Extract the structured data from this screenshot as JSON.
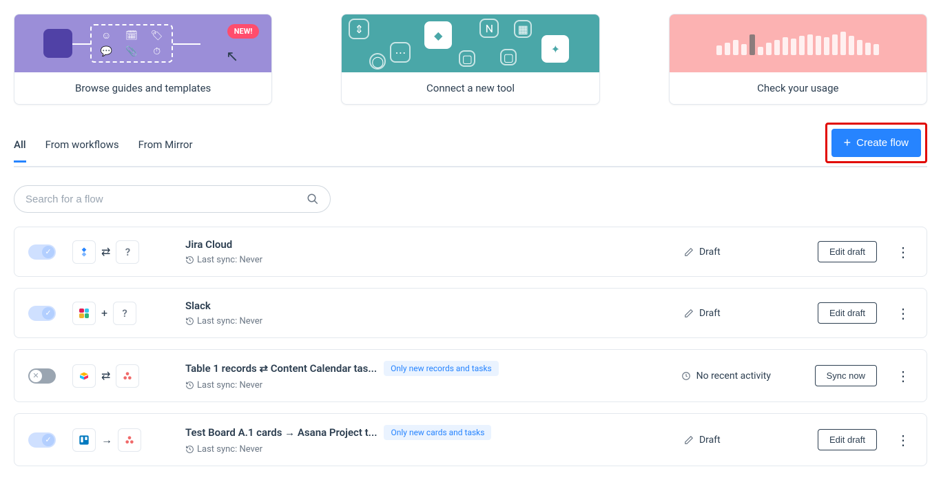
{
  "promo_cards": [
    {
      "label": "Browse guides and templates",
      "new_badge": "NEW!"
    },
    {
      "label": "Connect a new tool"
    },
    {
      "label": "Check your usage"
    }
  ],
  "tabs": {
    "all": "All",
    "from_workflows": "From workflows",
    "from_mirror": "From Mirror"
  },
  "create_button_label": "Create flow",
  "search_placeholder": "Search for a flow",
  "last_sync_prefix": "Last sync:",
  "flows": [
    {
      "title": "Jira Cloud",
      "last_sync": "Never",
      "status_label": "Draft",
      "status_type": "draft",
      "action_label": "Edit draft",
      "toggle_state": "on",
      "mid_arrow": "bidirectional",
      "left_icon": "jira",
      "right_icon": "question",
      "badge": null
    },
    {
      "title": "Slack",
      "last_sync": "Never",
      "status_label": "Draft",
      "status_type": "draft",
      "action_label": "Edit draft",
      "toggle_state": "on",
      "mid_arrow": "plus",
      "left_icon": "slack",
      "right_icon": "question",
      "badge": null
    },
    {
      "title": "Table 1 records ⇄ Content Calendar tas...",
      "last_sync": "Never",
      "status_label": "No recent activity",
      "status_type": "clock",
      "action_label": "Sync now",
      "toggle_state": "off",
      "mid_arrow": "bidirectional",
      "left_icon": "airtable",
      "right_icon": "asana",
      "badge": "Only new records and tasks"
    },
    {
      "title": "Test Board A.1 cards → Asana Project t...",
      "last_sync": "Never",
      "status_label": "Draft",
      "status_type": "draft",
      "action_label": "Edit draft",
      "toggle_state": "on",
      "mid_arrow": "right",
      "left_icon": "trello",
      "right_icon": "asana",
      "badge": "Only new cards and tasks"
    }
  ]
}
